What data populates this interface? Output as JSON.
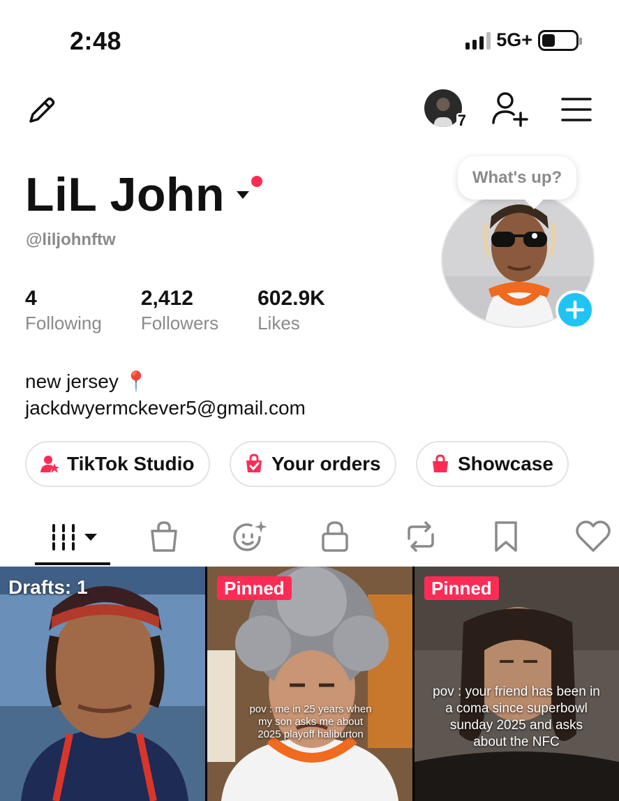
{
  "status_bar": {
    "time": "2:48",
    "network": "5G+"
  },
  "top_bar": {
    "account_count": "7"
  },
  "profile": {
    "display_name": "LiL John",
    "username": "@liljohnftw",
    "avatar_bubble": "What's up?",
    "stats": [
      {
        "value": "4",
        "label": "Following"
      },
      {
        "value": "2,412",
        "label": "Followers"
      },
      {
        "value": "602.9K",
        "label": "Likes"
      }
    ],
    "bio_line1": "new jersey 📍",
    "bio_line2": "jackdwyermckever5@gmail.com"
  },
  "actions": [
    {
      "label": "TikTok Studio",
      "icon": "studio-icon"
    },
    {
      "label": "Your orders",
      "icon": "orders-icon"
    },
    {
      "label": "Showcase",
      "icon": "shopping-bag-icon"
    }
  ],
  "tabs": [
    {
      "name": "videos",
      "icon": "grid-icon",
      "active": true
    },
    {
      "name": "shop",
      "icon": "shopping-bag-icon"
    },
    {
      "name": "ai-self",
      "icon": "face-sparkle-icon"
    },
    {
      "name": "private",
      "icon": "lock-icon"
    },
    {
      "name": "reposts",
      "icon": "repost-icon"
    },
    {
      "name": "favorites",
      "icon": "bookmark-icon"
    },
    {
      "name": "liked",
      "icon": "heart-icon"
    }
  ],
  "videos": [
    {
      "badge": "Drafts: 1",
      "caption": ""
    },
    {
      "badge": "Pinned",
      "caption": "pov : me in 25 years when my son asks me about 2025 playoff haliburton"
    },
    {
      "badge": "Pinned",
      "caption": "pov : your friend has been in a coma since superbowl sunday 2025 and asks about the NFC"
    }
  ],
  "colors": {
    "accent": "#fe2c55",
    "add_story": "#20c4f4",
    "secondary_text": "#8a8a8a"
  }
}
